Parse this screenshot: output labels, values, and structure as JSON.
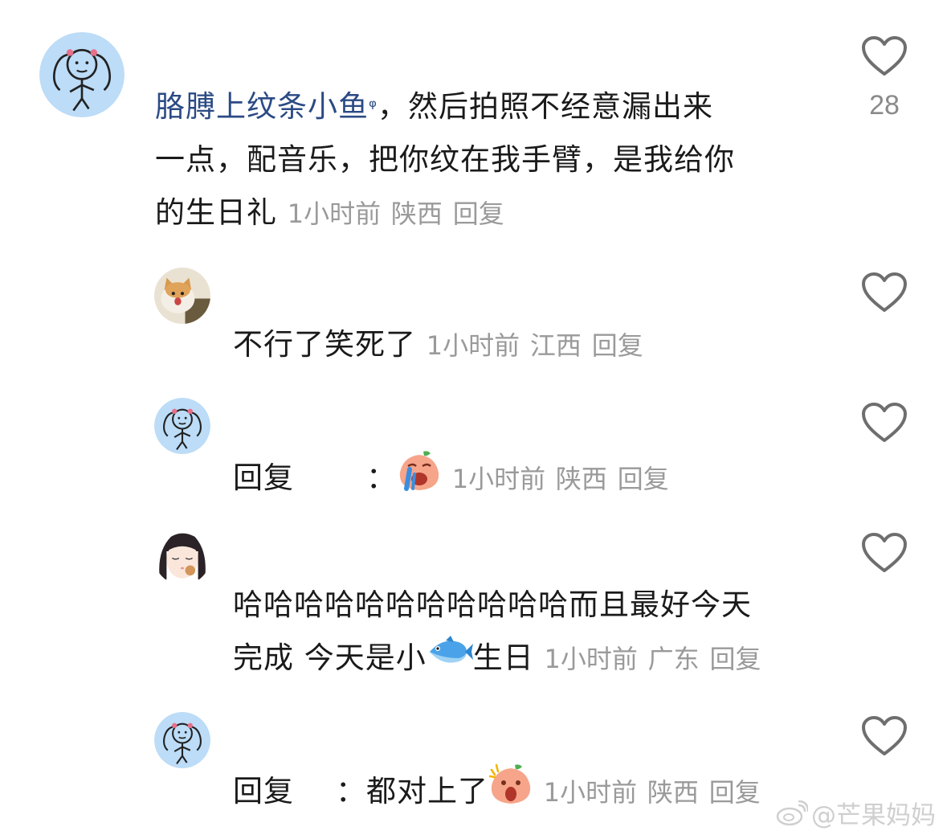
{
  "comments": [
    {
      "link_text": "胳膊上纹条小鱼",
      "text_line1_rest": "，然后拍照不经意漏出来",
      "text_line2": "一点，配音乐，把你纹在我手臂，是我给你",
      "text_line3": "的生日礼",
      "time": "1小时前",
      "location": "陕西",
      "reply_label": "回复",
      "likes": "28",
      "avatar_icon": "stick-girl-avatar"
    },
    {
      "text": "不行了笑死了",
      "time": "1小时前",
      "location": "江西",
      "reply_label": "回复",
      "avatar_icon": "cat-avatar"
    },
    {
      "reply_prefix": "回复",
      "colon": "：",
      "emoji": "crying-peach-emoji",
      "time": "1小时前",
      "location": "陕西",
      "reply_label": "回复",
      "avatar_icon": "stick-girl-avatar"
    },
    {
      "text_line1": "哈哈哈哈哈哈哈哈哈哈哈而且最好今天",
      "text_line2_a": "完成 今天是小",
      "text_line2_b": "生日",
      "emoji": "fish-emoji",
      "time": "1小时前",
      "location": "广东",
      "reply_label": "回复",
      "avatar_icon": "anime-girl-avatar"
    },
    {
      "reply_prefix": "回复",
      "text": "：都对上了",
      "emoji": "shocked-peach-emoji",
      "time": "1小时前",
      "location": "陕西",
      "reply_label": "回复",
      "avatar_icon": "stick-girl-avatar"
    }
  ],
  "watermark": "@芒果妈妈",
  "colors": {
    "link": "#2b4a84",
    "meta": "#9a9a9a",
    "avatar_bg": "#bcdcf7",
    "heart": "#6e6e6e"
  }
}
